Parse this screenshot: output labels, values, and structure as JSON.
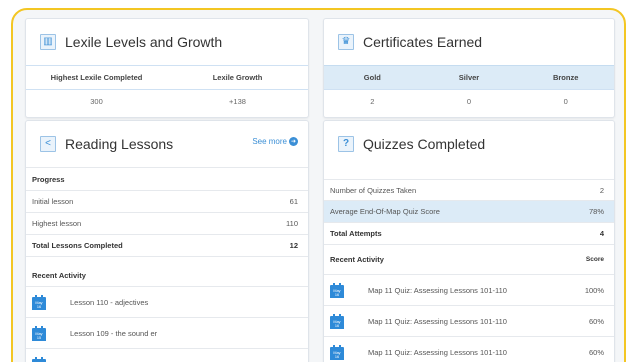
{
  "colors": {
    "frame_border": "#f3c623",
    "accent": "#3b8fd6",
    "highlight_row": "#dcebf7"
  },
  "lexile": {
    "title": "Lexile Levels and Growth",
    "icon": "bar-chart-icon",
    "headers": [
      "Highest Lexile Completed",
      "Lexile Growth"
    ],
    "values": [
      "300",
      "+138"
    ]
  },
  "certificates": {
    "title": "Certificates Earned",
    "icon": "trophy-icon",
    "headers": [
      "Gold",
      "Silver",
      "Bronze"
    ],
    "values": [
      "2",
      "0",
      "0"
    ]
  },
  "reading": {
    "title": "Reading Lessons",
    "icon": "share-icon",
    "see_more": "See more",
    "progress_label": "Progress",
    "rows": [
      {
        "label": "Initial lesson",
        "value": "61"
      },
      {
        "label": "Highest lesson",
        "value": "110"
      },
      {
        "label": "Total Lessons Completed",
        "value": "12"
      }
    ],
    "recent_label": "Recent Activity",
    "activities": [
      {
        "month": "May",
        "day": "16",
        "text": "Lesson 110 - adjectives"
      },
      {
        "month": "May",
        "day": "15",
        "text": "Lesson 109 - the sound er"
      }
    ]
  },
  "quizzes": {
    "title": "Quizzes Completed",
    "icon": "question-icon",
    "rows": [
      {
        "label": "Number of Quizzes Taken",
        "value": "2"
      },
      {
        "label": "Average End-Of-Map Quiz Score",
        "value": "78%"
      },
      {
        "label": "Total Attempts",
        "value": "4"
      }
    ],
    "recent_label": "Recent Activity",
    "score_label": "Score",
    "activities": [
      {
        "month": "May",
        "day": "16",
        "text": "Map 11 Quiz: Assessing Lessons 101-110",
        "score": "100%"
      },
      {
        "month": "May",
        "day": "16",
        "text": "Map 11 Quiz: Assessing Lessons 101-110",
        "score": "60%"
      },
      {
        "month": "May",
        "day": "16",
        "text": "Map 11 Quiz: Assessing Lessons 101-110",
        "score": "60%"
      }
    ]
  }
}
